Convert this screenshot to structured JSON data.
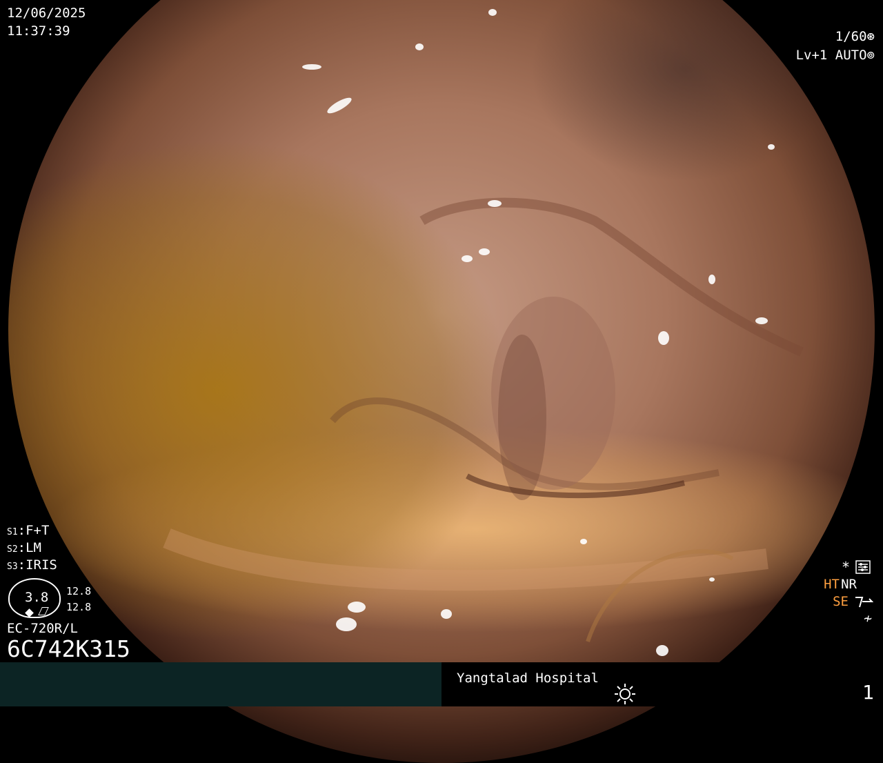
{
  "overlay": {
    "date": "12/06/2025",
    "time": "11:37:39",
    "shutter": "1/60",
    "level": "Lv+1 AUTO",
    "s1": {
      "key": "S1",
      "value": "F+T"
    },
    "s2": {
      "key": "S2",
      "value": "LM"
    },
    "s3": {
      "key": "S3",
      "value": "IRIS"
    },
    "gauge_value": "3.8",
    "gauge_r1": "12.8",
    "gauge_r2": "12.8",
    "scope_model": "EC-720R/L",
    "serial": "6C742K315",
    "indicators": {
      "star": "*",
      "ht": "HT",
      "nr": "NR",
      "se": "SE",
      "lightning": "≁"
    }
  },
  "footer": {
    "hospital": "Yangtalad Hospital",
    "image_number": "1"
  },
  "icons": {
    "shutter": "aperture-icon",
    "auto": "iris-icon",
    "menu": "settings-panel-icon",
    "se": "structure-enhance-icon",
    "light": "sun-icon"
  },
  "colors": {
    "indicator_orange": "#ffa040",
    "footer_bar": "#0c2424"
  }
}
